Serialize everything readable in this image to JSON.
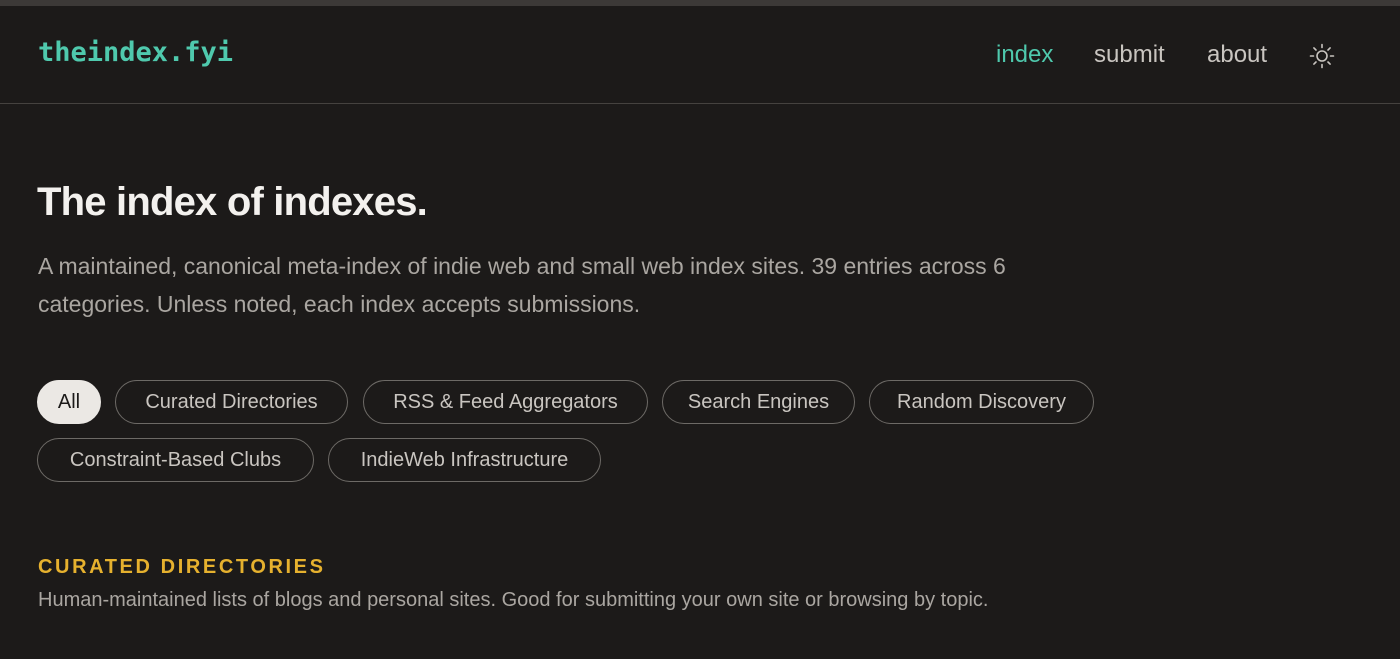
{
  "header": {
    "logo": "theindex.fyi",
    "nav": {
      "index": "index",
      "submit": "submit",
      "about": "about"
    },
    "theme_icon": "sun-icon"
  },
  "hero": {
    "title": "The index of indexes.",
    "description": "A maintained, canonical meta-index of indie web and small web index sites. 39 entries across 6 categories. Unless noted, each index accepts submissions."
  },
  "filters": {
    "active": "All",
    "items": [
      "All",
      "Curated Directories",
      "RSS & Feed Aggregators",
      "Search Engines",
      "Random Discovery",
      "Constraint-Based Clubs",
      "IndieWeb Infrastructure"
    ]
  },
  "section": {
    "title": "CURATED DIRECTORIES",
    "description": "Human-maintained lists of blogs and personal sites. Good for submitting your own site or browsing by topic."
  },
  "colors": {
    "background": "#1c1a19",
    "accent": "#4fc9ad",
    "section_heading": "#e6b12e",
    "muted_text": "#aaa6a1"
  }
}
